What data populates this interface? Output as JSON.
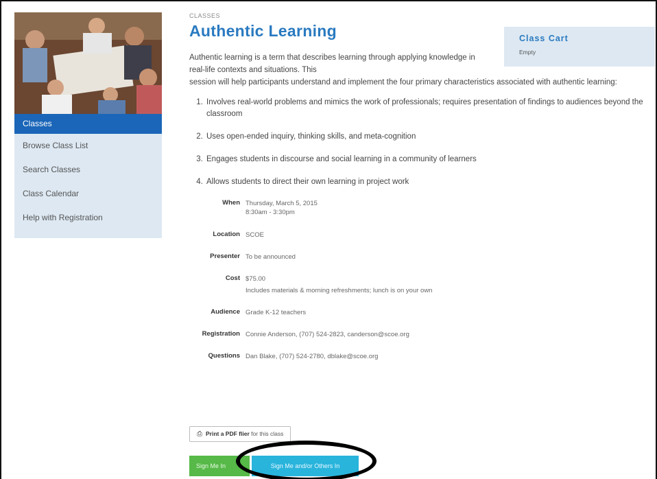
{
  "sidebar": {
    "items": [
      {
        "label": "Classes",
        "active": true
      },
      {
        "label": "Browse Class List",
        "active": false
      },
      {
        "label": "Search Classes",
        "active": false
      },
      {
        "label": "Class Calendar",
        "active": false
      },
      {
        "label": "Help with Registration",
        "active": false
      }
    ]
  },
  "main": {
    "eyebrow": "CLASSES",
    "title": "Authentic Learning",
    "intro_line1": "Authentic learning is a term that describes learning through applying knowledge in real-life contexts and situations. This",
    "intro_line2": "session will help participants understand and implement the four primary characteristics associated with authentic learning:",
    "list": [
      "Involves real-world problems and mimics the work of professionals; requires presentation of findings to audiences beyond the classroom",
      "Uses open-ended inquiry, thinking skills, and meta-cognition",
      "Engages students in discourse and social learning in a community of learners",
      "Allows students to direct their own learning in project work"
    ]
  },
  "details": {
    "when_label": "When",
    "when_date": "Thursday, March 5, 2015",
    "when_time": "8:30am - 3:30pm",
    "location_label": "Location",
    "location_value": "SCOE",
    "presenter_label": "Presenter",
    "presenter_value": "To be announced",
    "cost_label": "Cost",
    "cost_value": "$75.00",
    "cost_note": "Includes materials & morning refreshments; lunch is on your own",
    "audience_label": "Audience",
    "audience_value": "Grade K-12 teachers",
    "registration_label": "Registration",
    "registration_value": "Connie Anderson, (707) 524-2823, canderson@scoe.org",
    "questions_label": "Questions",
    "questions_value": "Dan Blake, (707) 524-2780, dblake@scoe.org"
  },
  "actions": {
    "pdf_bold": "Print a PDF flier",
    "pdf_rest": " for this class",
    "sign_me_in": "Sign Me In",
    "sign_me_others": "Sign Me and/or Others In"
  },
  "cart": {
    "title": "Class Cart",
    "status": "Empty"
  },
  "colors": {
    "accent": "#2a7ac0",
    "active_nav": "#1b66b8",
    "sidebar_bg": "#dde8f2",
    "green_button": "#56b948",
    "blue_button": "#29b4dc"
  }
}
